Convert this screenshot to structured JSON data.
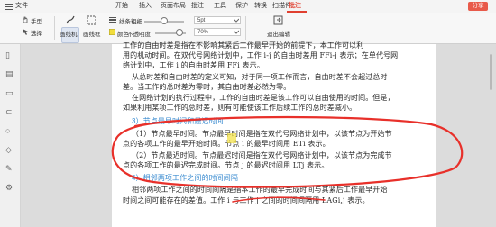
{
  "menu": {
    "file": "文件",
    "tabs": [
      "开始",
      "插入",
      "页面布局",
      "批注",
      "工具",
      "保护",
      "转换",
      "扫描件",
      "批注"
    ],
    "active_index": 8
  },
  "share_label": "分享",
  "toolbar": {
    "hand": "手型",
    "select": "选择",
    "highlight": "画线机",
    "area_highlight": "画线框",
    "line_thickness_label": "线条粗细",
    "line_thickness_value": "5pt",
    "color_label": "颜色",
    "opacity_label": "不透明度",
    "opacity_value": "70%",
    "exit_label": "退出编辑"
  },
  "doc": {
    "lines": [
      "工作的自由时差是指在不影响其紧后工作最早开始的前提下，本工作可以利",
      "用的机动时间。在双代号网络计划中，工作 i-j 的自由时差用 FFi-j 表示；在单代号网",
      "络计划中，工作 i 的自由时差用 FFi 表示。",
      "从总时差和自由时差的定义可知，对于同一项工作而言，自由时差不会超过总时",
      "差。当工作的总时差为零时，其自由时差必然为零。",
      "在网络计划的执行过程中，工作的自由时差是该工作可以自由使用的时间。但是，",
      "如果利用某项工作的总时差，则有可能使该工作后续工作的总时差减小。"
    ],
    "heading3": "3）节点最早时间和最迟时间",
    "para1_a": "（1）节点最早时间。节点最早时间是指在双代号网络计划中，以该节点为开始节",
    "para1_b": "点的各项工作的最早开始时间。节点 i 的最早时间用 ETi 表示。",
    "para2_a": "（2）节点最迟时间。节点最迟时间是指在双代号网络计划中，以该节点为完成节",
    "para2_b": "点的各项工作的最迟完成时间。节点 j 的最迟时间用 LTj 表示。",
    "heading4": "4）相邻两项工作之间的时间间隔",
    "para3_a": "相邻两项工作之间的时间间隔是指本工作的最早完成时间与其紧后工作最早开始",
    "para3_b": "时间之间可能存在的差值。工作 i 与工作 j 之间的时间间隔用 LAGi,j 表示。"
  },
  "colors": {
    "annotation": "#e8302a",
    "highlight": "#f3e24a",
    "heading": "#3a8bd0",
    "accent": "#e04030"
  }
}
